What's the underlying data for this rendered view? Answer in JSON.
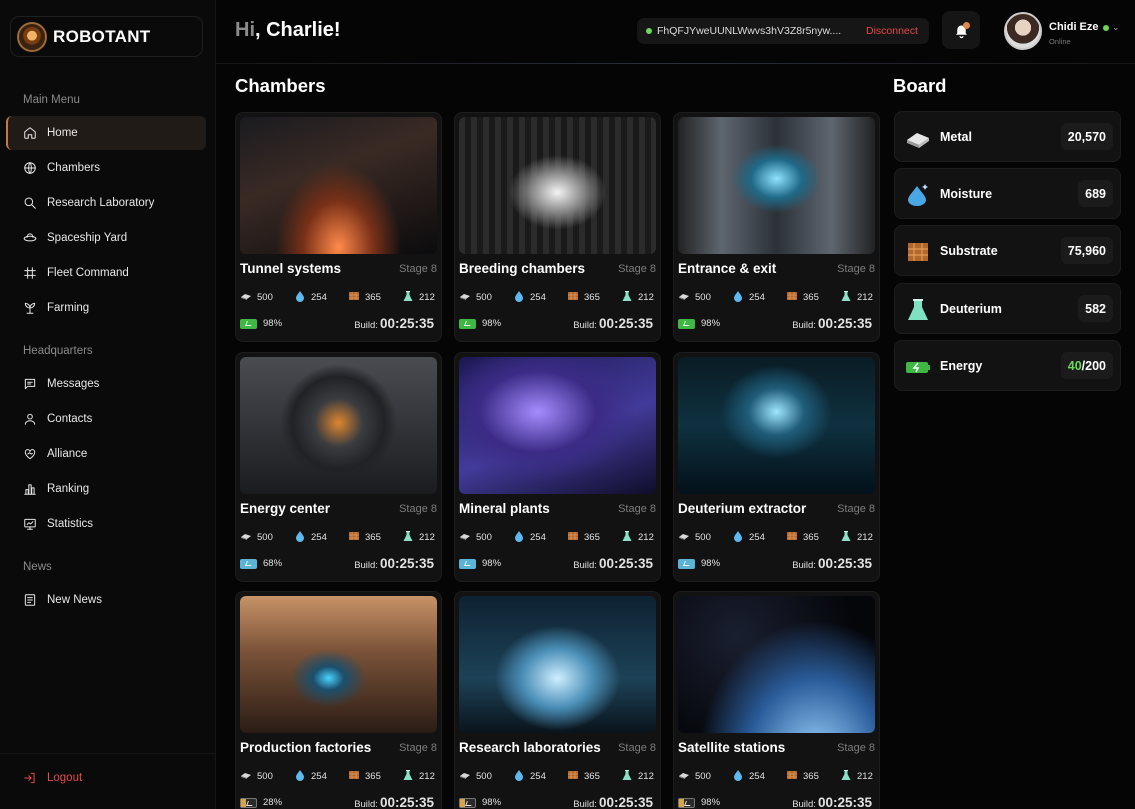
{
  "brand": {
    "name": "ROBOTANT"
  },
  "sidebar": {
    "main_menu_title": "Main Menu",
    "main_menu": [
      {
        "label": "Home",
        "icon": "home-icon",
        "active": true
      },
      {
        "label": "Chambers",
        "icon": "globe-icon"
      },
      {
        "label": "Research Laboratory",
        "icon": "search-icon"
      },
      {
        "label": "Spaceship Yard",
        "icon": "spaceship-icon"
      },
      {
        "label": "Fleet Command",
        "icon": "fleet-icon"
      },
      {
        "label": "Farming",
        "icon": "sprout-icon"
      }
    ],
    "hq_title": "Headquarters",
    "hq_menu": [
      {
        "label": "Messages",
        "icon": "message-icon"
      },
      {
        "label": "Contacts",
        "icon": "user-icon"
      },
      {
        "label": "Alliance",
        "icon": "alliance-icon"
      },
      {
        "label": "Ranking",
        "icon": "ranking-icon"
      },
      {
        "label": "Statistics",
        "icon": "statistics-icon"
      }
    ],
    "news_title": "News",
    "news_menu": [
      {
        "label": "New News",
        "icon": "news-icon"
      }
    ],
    "logout_label": "Logout"
  },
  "header": {
    "greeting_prefix": "Hi",
    "greeting_name": ", Charlie!",
    "wallet_address": "FhQFJYweUUNLWwvs3hV3Z8r5nyw....",
    "disconnect_label": "Disconnect",
    "user_name": "Chidi Eze",
    "user_status": "Online"
  },
  "chambers": {
    "title": "Chambers",
    "build_label": "Build:",
    "items": [
      {
        "name": "Tunnel systems",
        "stage": "Stage 8",
        "metal": "500",
        "moisture": "254",
        "substrate": "365",
        "deuterium": "212",
        "energy": "98%",
        "energy_style": "green",
        "build": "00:25:35"
      },
      {
        "name": "Breeding chambers",
        "stage": "Stage 8",
        "metal": "500",
        "moisture": "254",
        "substrate": "365",
        "deuterium": "212",
        "energy": "98%",
        "energy_style": "green",
        "build": "00:25:35"
      },
      {
        "name": "Entrance & exit",
        "stage": "Stage 8",
        "metal": "500",
        "moisture": "254",
        "substrate": "365",
        "deuterium": "212",
        "energy": "98%",
        "energy_style": "green",
        "build": "00:25:35"
      },
      {
        "name": "Energy center",
        "stage": "Stage 8",
        "metal": "500",
        "moisture": "254",
        "substrate": "365",
        "deuterium": "212",
        "energy": "68%",
        "energy_style": "blue",
        "build": "00:25:35"
      },
      {
        "name": "Mineral plants",
        "stage": "Stage 8",
        "metal": "500",
        "moisture": "254",
        "substrate": "365",
        "deuterium": "212",
        "energy": "98%",
        "energy_style": "blue",
        "build": "00:25:35"
      },
      {
        "name": "Deuterium extractor",
        "stage": "Stage 8",
        "metal": "500",
        "moisture": "254",
        "substrate": "365",
        "deuterium": "212",
        "energy": "98%",
        "energy_style": "blue",
        "build": "00:25:35"
      },
      {
        "name": "Production factories",
        "stage": "Stage 8",
        "metal": "500",
        "moisture": "254",
        "substrate": "365",
        "deuterium": "212",
        "energy": "28%",
        "energy_style": "low",
        "build": "00:25:35"
      },
      {
        "name": "Research laboratories",
        "stage": "Stage 8",
        "metal": "500",
        "moisture": "254",
        "substrate": "365",
        "deuterium": "212",
        "energy": "98%",
        "energy_style": "low",
        "build": "00:25:35"
      },
      {
        "name": "Satellite stations",
        "stage": "Stage 8",
        "metal": "500",
        "moisture": "254",
        "substrate": "365",
        "deuterium": "212",
        "energy": "98%",
        "energy_style": "low",
        "build": "00:25:35"
      }
    ]
  },
  "board": {
    "title": "Board",
    "items": [
      {
        "label": "Metal",
        "value": "20,570",
        "icon": "metal-icon"
      },
      {
        "label": "Moisture",
        "value": "689",
        "icon": "moisture-icon"
      },
      {
        "label": "Substrate",
        "value": "75,960",
        "icon": "substrate-icon"
      },
      {
        "label": "Deuterium",
        "value": "582",
        "icon": "deuterium-icon"
      },
      {
        "label": "Energy",
        "value_current": "40",
        "value_max": "/200",
        "icon": "energy-icon"
      }
    ]
  },
  "colors": {
    "accent": "#c47a48",
    "energy_green": "#6bd85a",
    "danger": "#e5484d"
  }
}
